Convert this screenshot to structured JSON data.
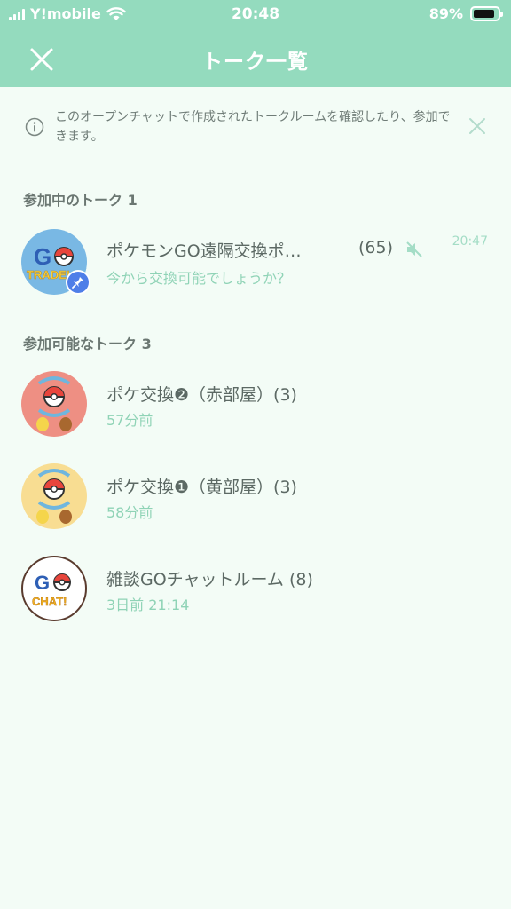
{
  "status_bar": {
    "carrier": "Y!mobile",
    "time": "20:48",
    "battery": "89%",
    "battery_level": 0.89
  },
  "header": {
    "title": "トーク一覧"
  },
  "notice": {
    "text": "このオープンチャットで作成されたトークルームを確認したり、参加できます。"
  },
  "joined_section": {
    "label": "参加中のトーク 1",
    "rooms": [
      {
        "name": "ポケモンGO遠隔交換ポ…",
        "count": "(65)",
        "preview": "今から交換可能でしょうか？",
        "time": "20:47",
        "avatar_text": "GO TRADE!",
        "muted": true,
        "pinned": true
      }
    ]
  },
  "available_section": {
    "label": "参加可能なトーク 3",
    "rooms": [
      {
        "name": "ポケ交換❷（赤部屋）(3)",
        "sub": "57分前",
        "avatar_color": "#ee8f83"
      },
      {
        "name": "ポケ交換❶（黄部屋）(3)",
        "sub": "58分前",
        "avatar_color": "#f8dd92"
      },
      {
        "name": "雑談GOチャットルーム (8)",
        "sub": "3日前 21:14",
        "avatar_text": "CHAT!"
      }
    ]
  },
  "colors": {
    "header_bg": "#94dbbe",
    "accent_text": "#8fd3b6",
    "page_bg": "#f3fcf6"
  }
}
